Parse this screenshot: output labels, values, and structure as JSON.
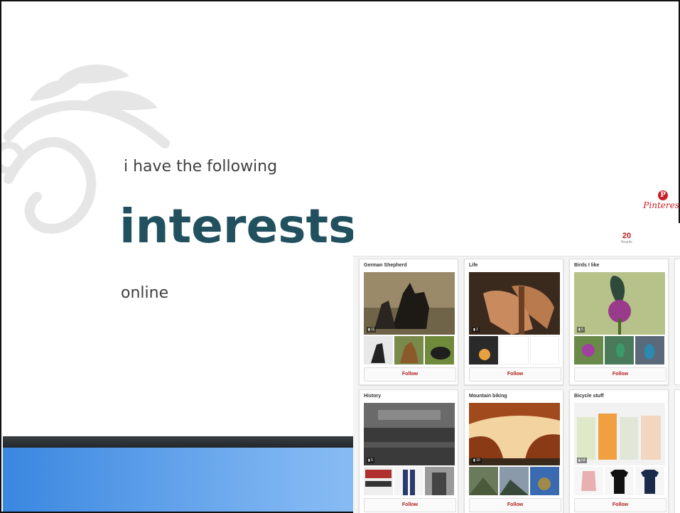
{
  "slide": {
    "subtitle_top": "i have the following",
    "title": "interests",
    "subtitle_bottom": "online"
  },
  "pinterest": {
    "logo_text": "Pinterest",
    "logo_mark": "P",
    "boards_count": "20",
    "boards_label": "Boards",
    "follow_label": "Follow",
    "boards": [
      {
        "name": "German Shepherd",
        "count": "▮ 11"
      },
      {
        "name": "Life",
        "count": "▮ 2"
      },
      {
        "name": "Birds I like",
        "count": "▮ 5"
      },
      {
        "name": "History",
        "count": "▮ 5"
      },
      {
        "name": "Mountain biking",
        "count": "▮ 10"
      },
      {
        "name": "Bicycle stuff",
        "count": "▮ 54"
      }
    ]
  },
  "colors": {
    "title": "#21505f",
    "accent_red": "#cb2027",
    "bar_dark": "#2b2f33",
    "bar_blue": "#5aa0ea"
  }
}
